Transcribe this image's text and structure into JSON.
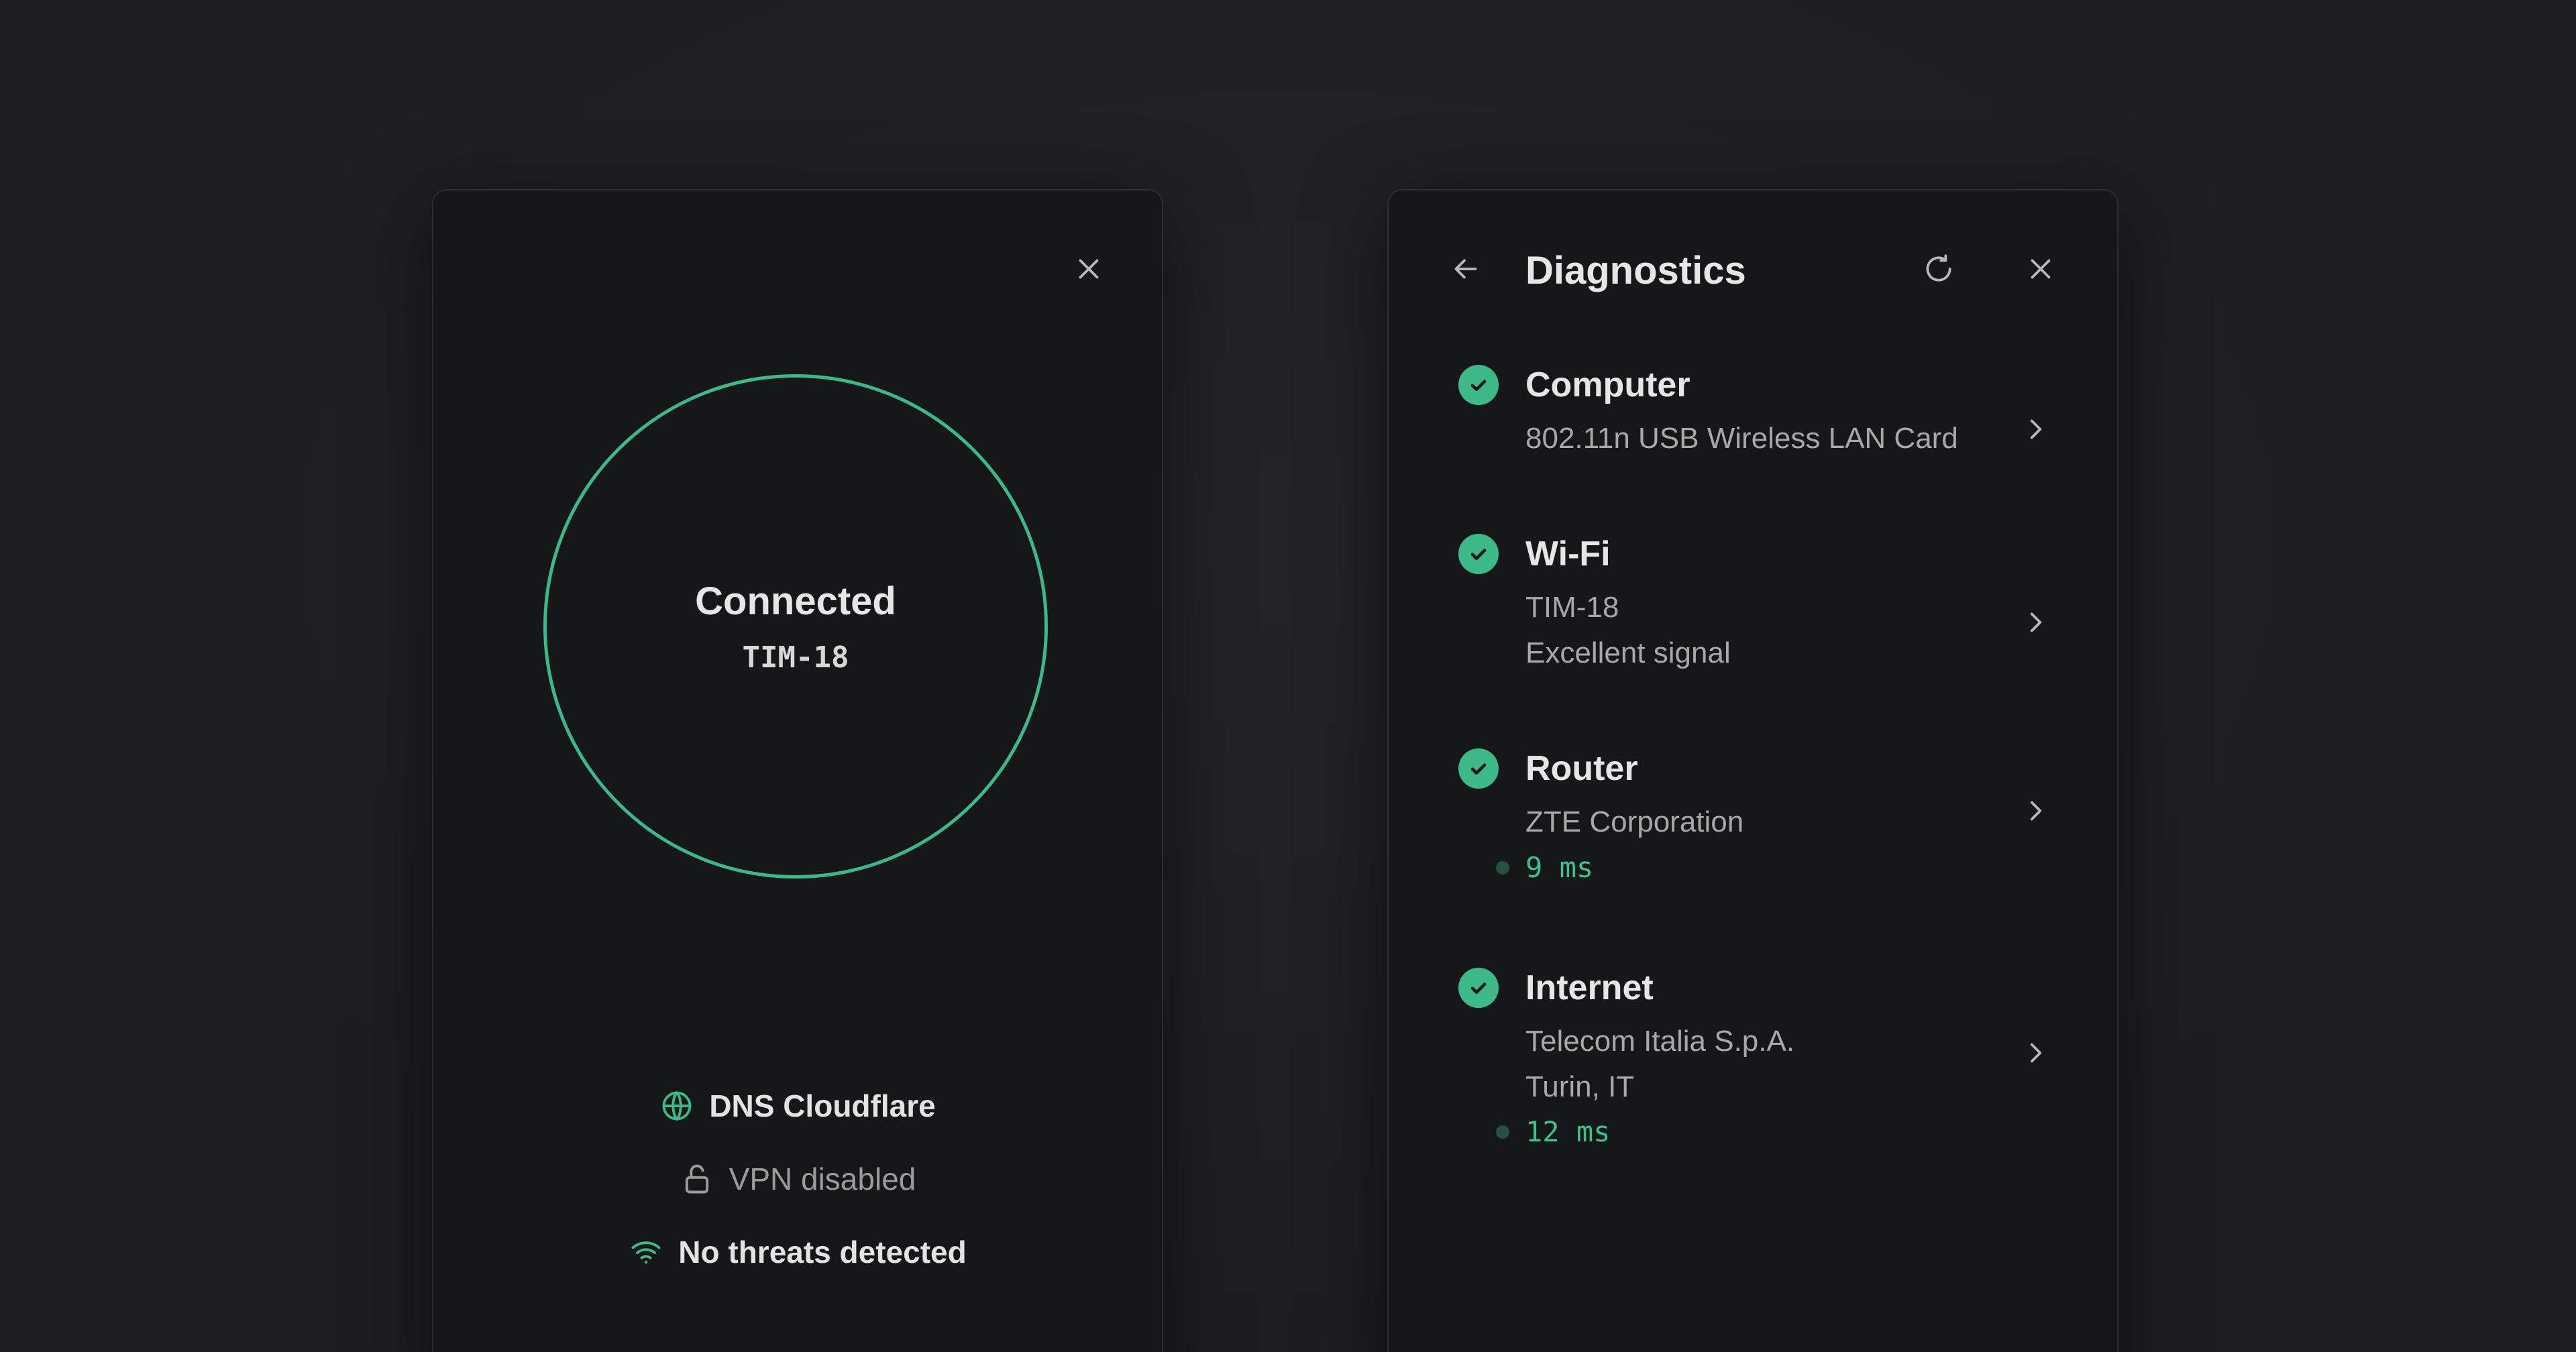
{
  "left_panel": {
    "status_title": "Connected",
    "network_name": "TIM-18",
    "dns": "DNS Cloudflare",
    "vpn": "VPN disabled",
    "threats": "No threats detected"
  },
  "right_panel": {
    "title": "Diagnostics",
    "items": [
      {
        "title": "Computer",
        "lines": [
          "802.11n USB Wireless LAN Card"
        ]
      },
      {
        "title": "Wi-Fi",
        "lines": [
          "TIM-18",
          "Excellent signal"
        ]
      },
      {
        "title": "Router",
        "lines": [
          "ZTE Corporation"
        ],
        "latency": "9 ms"
      },
      {
        "title": "Internet",
        "lines": [
          "Telecom Italia S.p.A.",
          "Turin, IT"
        ],
        "latency": "12 ms"
      }
    ]
  },
  "colors": {
    "accent": "#3db888",
    "background": "#1d1f22",
    "card": "#161719"
  },
  "icons": {
    "close": "close-icon",
    "back": "arrow-left-icon",
    "refresh": "refresh-icon",
    "dns": "globe-icon",
    "vpn": "unlock-icon",
    "threats": "wifi-icon",
    "status": "check-circle-icon",
    "chevron": "chevron-right-icon"
  }
}
